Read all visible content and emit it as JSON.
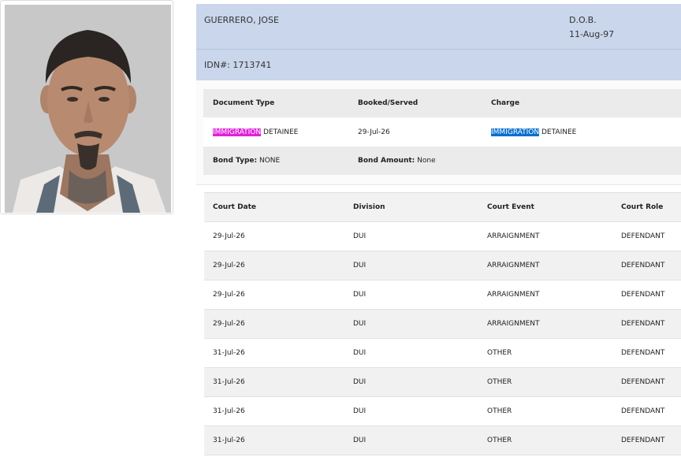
{
  "inmate": {
    "name": "GUERRERO, JOSE",
    "dob_label": "D.O.B.",
    "dob": "11-Aug-97",
    "idn_label": "IDN#:",
    "idn": "1713741"
  },
  "booking": {
    "headers": [
      "Document Type",
      "Booked/Served",
      "Charge"
    ],
    "document_type_highlight": "IMMIGRATION",
    "document_type_rest": " DETAINEE",
    "booked_served": "29-Jul-26",
    "charge_highlight": "IMMIGRATION",
    "charge_rest": " DETAINEE",
    "bond_type_label": "Bond Type:",
    "bond_type": " NONE",
    "bond_amount_label": "Bond Amount:",
    "bond_amount": " None"
  },
  "court": {
    "headers": [
      "Court Date",
      "Division",
      "Court Event",
      "Court Role"
    ],
    "rows": [
      [
        "29-Jul-26",
        "DUI",
        "ARRAIGNMENT",
        "DEFENDANT"
      ],
      [
        "29-Jul-26",
        "DUI",
        "ARRAIGNMENT",
        "DEFENDANT"
      ],
      [
        "29-Jul-26",
        "DUI",
        "ARRAIGNMENT",
        "DEFENDANT"
      ],
      [
        "29-Jul-26",
        "DUI",
        "ARRAIGNMENT",
        "DEFENDANT"
      ],
      [
        "31-Jul-26",
        "DUI",
        "OTHER",
        "DEFENDANT"
      ],
      [
        "31-Jul-26",
        "DUI",
        "OTHER",
        "DEFENDANT"
      ],
      [
        "31-Jul-26",
        "DUI",
        "OTHER",
        "DEFENDANT"
      ],
      [
        "31-Jul-26",
        "DUI",
        "OTHER",
        "DEFENDANT"
      ]
    ]
  },
  "colors": {
    "header_bg": "#c9d6eb",
    "highlight_pink": "#e021d9",
    "highlight_blue": "#0a6fcf"
  }
}
